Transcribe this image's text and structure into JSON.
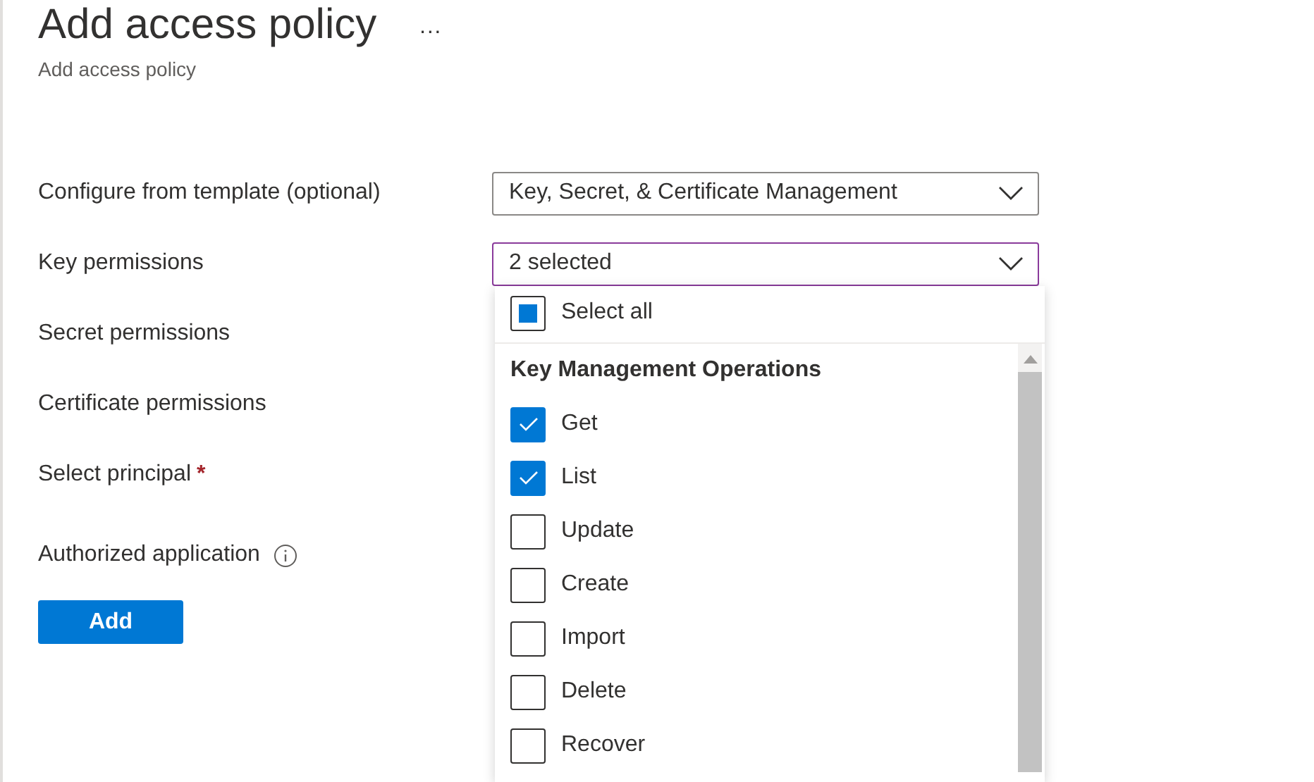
{
  "header": {
    "title": "Add access policy",
    "more": "···",
    "subtitle": "Add access policy"
  },
  "form": [
    {
      "label": "Configure from template (optional)",
      "kind": "dropdown",
      "value": "Key, Secret, & Certificate Management",
      "focused": false
    },
    {
      "label": "Key permissions",
      "kind": "dropdown",
      "value": "2 selected",
      "focused": true
    },
    {
      "label": "Secret permissions",
      "kind": "plain"
    },
    {
      "label": "Certificate permissions",
      "kind": "plain"
    },
    {
      "label": "Select principal",
      "kind": "plain",
      "required": "*"
    },
    {
      "label": "Authorized application",
      "kind": "info"
    }
  ],
  "add_button": "Add",
  "key_permissions_menu": {
    "select_all": {
      "label": "Select all",
      "indeterminate": true
    },
    "group": "Key Management Operations",
    "options": [
      {
        "label": "Get",
        "checked": true
      },
      {
        "label": "List",
        "checked": true
      },
      {
        "label": "Update",
        "checked": false
      },
      {
        "label": "Create",
        "checked": false
      },
      {
        "label": "Import",
        "checked": false
      },
      {
        "label": "Delete",
        "checked": false
      },
      {
        "label": "Recover",
        "checked": false
      }
    ]
  }
}
